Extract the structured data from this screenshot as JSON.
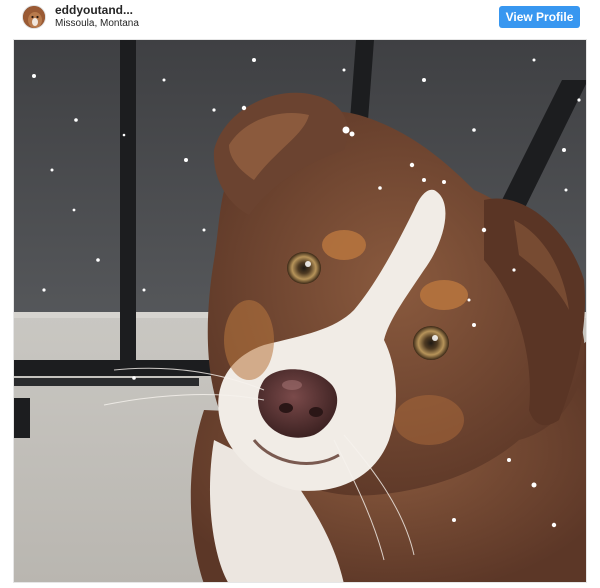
{
  "header": {
    "username": "eddyoutand...",
    "location": "Missoula, Montana",
    "view_profile_label": "View Profile"
  },
  "icons": {
    "avatar": "profile-avatar"
  },
  "colors": {
    "button_bg": "#3897f0",
    "button_text": "#ffffff",
    "text": "#262626"
  }
}
